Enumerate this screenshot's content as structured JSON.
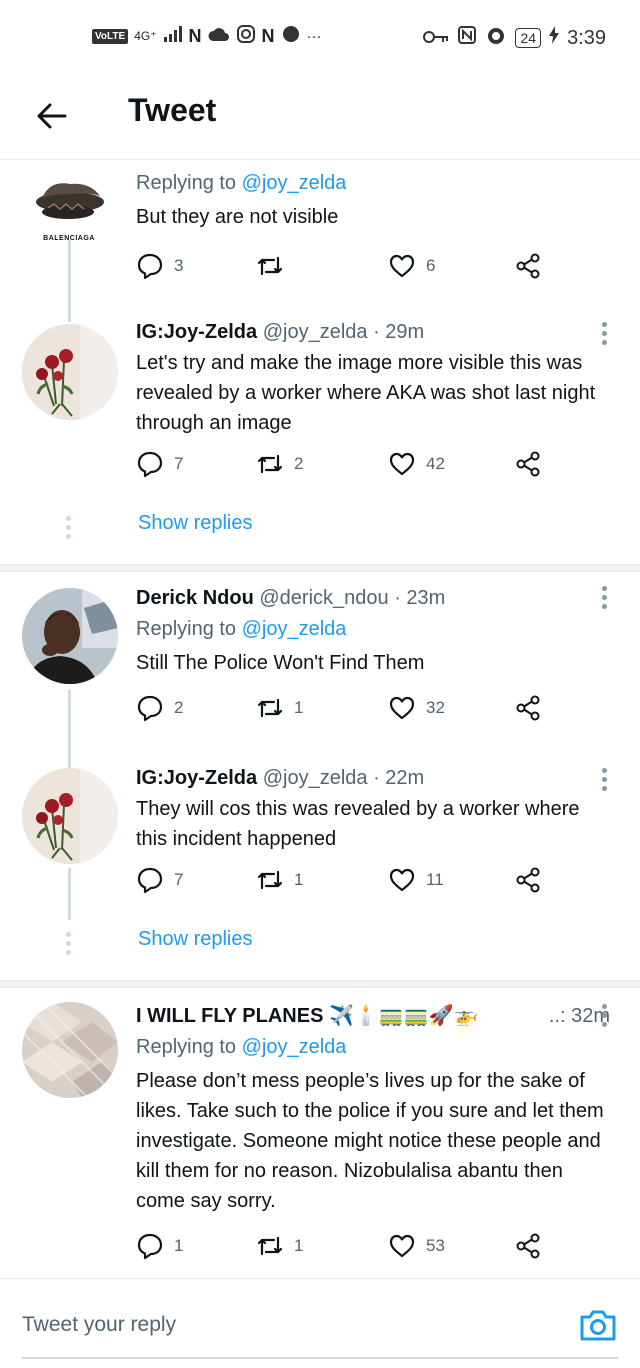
{
  "status_bar": {
    "volte": "VoLTE",
    "network": "4G⁺",
    "battery": "24",
    "time": "3:39",
    "more": "···"
  },
  "header": {
    "title": "Tweet"
  },
  "tweets": [
    {
      "replying_prefix": "Replying to ",
      "replying_to": "@joy_zelda",
      "text": "But they are not visible",
      "replies": "3",
      "retweets": "",
      "likes": "6"
    },
    {
      "name": "IG:Joy-Zelda",
      "handle": "@joy_zelda",
      "time": "· 29m",
      "text": "Let's try and make the image more visible this was revealed by a worker where AKA was shot last night through an image",
      "replies": "7",
      "retweets": "2",
      "likes": "42",
      "show_replies": "Show replies"
    },
    {
      "name": "Derick Ndou",
      "handle": "@derick_ndou",
      "time": "· 23m",
      "replying_prefix": "Replying to ",
      "replying_to": "@joy_zelda",
      "text": "Still The Police Won't Find Them",
      "replies": "2",
      "retweets": "1",
      "likes": "32"
    },
    {
      "name": "IG:Joy-Zelda",
      "handle": "@joy_zelda",
      "time": "· 22m",
      "text": "They will cos this was revealed by a worker where this incident happened",
      "replies": "7",
      "retweets": "1",
      "likes": "11",
      "show_replies": "Show replies"
    },
    {
      "name": "I WILL FLY PLANES ✈️🕯️🚃🚃🚀🚁",
      "time": "..: 32m",
      "replying_prefix": "Replying to ",
      "replying_to": "@joy_zelda",
      "text": "Please don’t mess people’s lives up for the sake of likes. Take such to the police if you sure and let them investigate. Someone might notice these people and kill them for no reason. Nizobulalisa abantu then come say sorry.",
      "replies": "1",
      "retweets": "1",
      "likes": "53"
    }
  ],
  "reply_bar": {
    "placeholder": "Tweet your reply"
  },
  "logo_text": "BALENCIAGA",
  "colors": {
    "accent": "#1d9bf0",
    "secondary_text": "#536471",
    "primary_text": "#0f1419"
  }
}
